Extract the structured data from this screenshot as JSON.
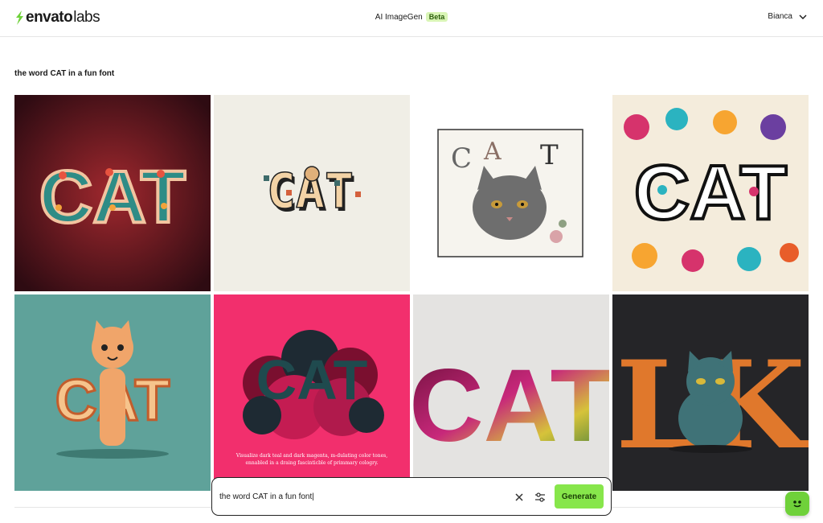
{
  "header": {
    "logo_main": "envato",
    "logo_sub": "labs",
    "app_title": "AI ImageGen",
    "badge": "Beta",
    "user_name": "Bianca"
  },
  "prompt_heading": "the word CAT in a fun font",
  "images": [
    {
      "label": "CAT",
      "style": "floral teal letters on dark red"
    },
    {
      "label": "CAT",
      "style": "pixel letters with cat"
    },
    {
      "label": "CAT",
      "style": "framed gray cat sketch"
    },
    {
      "label": "CAT",
      "style": "colorful folk art cats"
    },
    {
      "label": "CAT",
      "style": "orange cat on teal"
    },
    {
      "label": "CAT",
      "style": "dark letters on magenta smoke",
      "caption_lines": [
        "Visualize dark teal and dark magenta, m-dulating color tones,",
        "ennabled in a draing fascinticble of primmary cologry."
      ]
    },
    {
      "label": "CAT",
      "style": "gradient block letters"
    },
    {
      "label": "LK",
      "style": "blue cat between orange letters"
    }
  ],
  "prompt_bar": {
    "value": "the word CAT in a fun font|",
    "clear_icon": "close-icon",
    "settings_icon": "sliders-icon",
    "generate_label": "Generate"
  },
  "colors": {
    "accent": "#87e64b",
    "border": "#222222"
  }
}
